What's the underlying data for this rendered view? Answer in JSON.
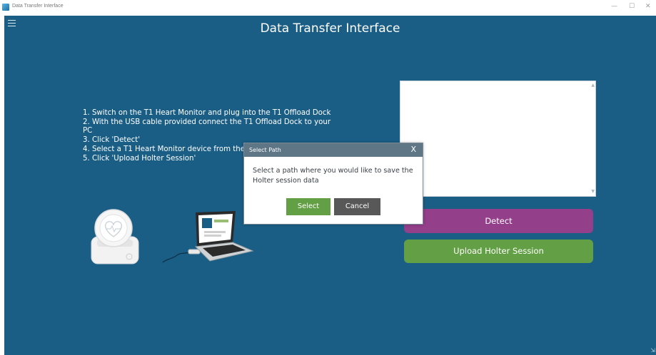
{
  "window": {
    "title": "Data Transfer Interface",
    "minimize_glyph": "—",
    "maximize_glyph": "☐",
    "close_glyph": "✕"
  },
  "app": {
    "title": "Data Transfer Interface",
    "menu_icon": "hamburger-icon"
  },
  "instructions": [
    "1. Switch on the T1 Heart Monitor and plug into the T1 Offload Dock",
    "2. With the USB cable provided connect the T1 Offload Dock to your PC",
    "3. Click 'Detect'",
    "4. Select a T1 Heart Monitor device from the li",
    "5. Click 'Upload Holter Session'"
  ],
  "device_list": {
    "items": [],
    "scroll_up_glyph": "▲",
    "scroll_down_glyph": "▼"
  },
  "buttons": {
    "detect": "Detect",
    "upload": "Upload Holter Session"
  },
  "dialog": {
    "title": "Select Path",
    "close_glyph": "X",
    "message": "Select a path where you would like to save the Holter session data",
    "select_label": "Select",
    "cancel_label": "Cancel"
  },
  "resize_glyph": "⇲",
  "colors": {
    "background": "#1a5e86",
    "detect": "#933f8a",
    "upload": "#63a045",
    "dialog_header": "#5f7686",
    "cancel": "#585858"
  }
}
